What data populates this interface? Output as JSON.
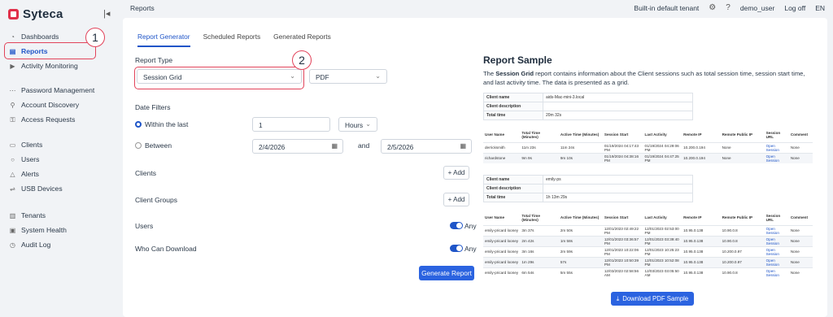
{
  "app": {
    "name": "Syteca"
  },
  "header": {
    "breadcrumb": "Reports",
    "tenant": "Built-in default tenant",
    "user": "demo_user",
    "logoff": "Log off",
    "language": "EN"
  },
  "sidebar": {
    "items": [
      {
        "label": "Dashboards",
        "icon": "dashboard-icon"
      },
      {
        "label": "Reports",
        "icon": "reports-icon",
        "active": true
      },
      {
        "label": "Activity Monitoring",
        "icon": "monitoring-icon"
      },
      {
        "label": "Password Management",
        "icon": "password-icon"
      },
      {
        "label": "Account Discovery",
        "icon": "discovery-icon"
      },
      {
        "label": "Access Requests",
        "icon": "access-icon"
      },
      {
        "label": "Clients",
        "icon": "monitor-icon"
      },
      {
        "label": "Users",
        "icon": "user-icon"
      },
      {
        "label": "Alerts",
        "icon": "bell-icon"
      },
      {
        "label": "USB Devices",
        "icon": "usb-icon"
      },
      {
        "label": "Tenants",
        "icon": "tenants-icon"
      },
      {
        "label": "System Health",
        "icon": "health-icon"
      },
      {
        "label": "Audit Log",
        "icon": "history-icon"
      }
    ]
  },
  "callouts": {
    "one": "1",
    "two": "2"
  },
  "tabs": [
    "Report Generator",
    "Scheduled Reports",
    "Generated Reports"
  ],
  "form": {
    "report_type_label": "Report Type",
    "report_type_value": "Session Grid",
    "format_value": "PDF",
    "date_filters_label": "Date Filters",
    "within_last_label": "Within the last",
    "within_last_value": "1",
    "within_last_unit": "Hours",
    "between_label": "Between",
    "date_from": "2/4/2026",
    "and_label": "and",
    "date_to": "2/5/2026",
    "clients_label": "Clients",
    "client_groups_label": "Client Groups",
    "add_label": "+ Add",
    "users_label": "Users",
    "who_can_download_label": "Who Can Download",
    "any_label": "Any",
    "generate_label": "Generate Report"
  },
  "sample": {
    "title": "Report Sample",
    "desc_prefix": "The ",
    "desc_bold": "Session Grid",
    "desc_rest": " report contains information about the Client sessions such as total session time, session start time, and last activity time. The data is presented as a grid.",
    "client_name_label": "Client name",
    "client_description_label": "Client description",
    "total_time_label": "Total time",
    "block1": {
      "client_name": "aids-Mac-mini-3.local",
      "client_description": "",
      "total_time": "20m 32s"
    },
    "block2": {
      "client_name": "emily-ps",
      "client_description": "",
      "total_time": "1h 13m 29s"
    },
    "columns": [
      "User Name",
      "Total Time (Minutes)",
      "Active Time (Minutes)",
      "Session Start",
      "Last Activity",
      "Remote IP",
      "Remote Public IP",
      "Session URL",
      "Comment"
    ],
    "rows1": [
      [
        "derricksmith",
        "11m 23s",
        "11m 24s",
        "01/19/2024 04:17:43 PM",
        "01/19/2024 04:29:06 PM",
        "10.200.0.194",
        "None",
        "Open Session",
        "None"
      ],
      [
        "richardstone",
        "9m 9s",
        "9m 10s",
        "01/19/2024 04:38:16 PM",
        "01/19/2024 04:47:25 PM",
        "10.200.0.194",
        "None",
        "Open Session",
        "None"
      ]
    ],
    "rows2": [
      [
        "emily-pricard looney",
        "3m 37s",
        "2m 50s",
        "12/01/2023 02:49:22 PM",
        "12/01/2023 02:53:00 PM",
        "10.95.0.138",
        "10.90.0.8",
        "Open Session",
        "None"
      ],
      [
        "emily-pricard looney",
        "2m 42s",
        "1m 58s",
        "12/01/2023 03:36:57 PM",
        "12/01/2023 03:39:40 PM",
        "10.95.0.138",
        "10.90.0.8",
        "Open Session",
        "None"
      ],
      [
        "emily-pricard looney",
        "3m 16s",
        "2m 59s",
        "12/01/2023 10:22:06 PM",
        "12/01/2023 10:25:23 PM",
        "10.95.0.138",
        "10.200.0.97",
        "Open Session",
        "None"
      ],
      [
        "emily-pricard looney",
        "1m 29s",
        "57s",
        "12/01/2023 10:50:39 PM",
        "12/01/2023 10:52:08 PM",
        "10.95.0.138",
        "10.200.0.97",
        "Open Session",
        "None"
      ],
      [
        "emily-pricard looney",
        "6m 54s",
        "5m 55s",
        "12/03/2023 02:58:56 AM",
        "12/03/2023 03:05:50 AM",
        "10.95.0.138",
        "10.90.0.8",
        "Open Session",
        "None"
      ]
    ],
    "download_label": "Download PDF Sample"
  },
  "colors": {
    "accent": "#2b63e0",
    "callout": "#e2435a"
  }
}
